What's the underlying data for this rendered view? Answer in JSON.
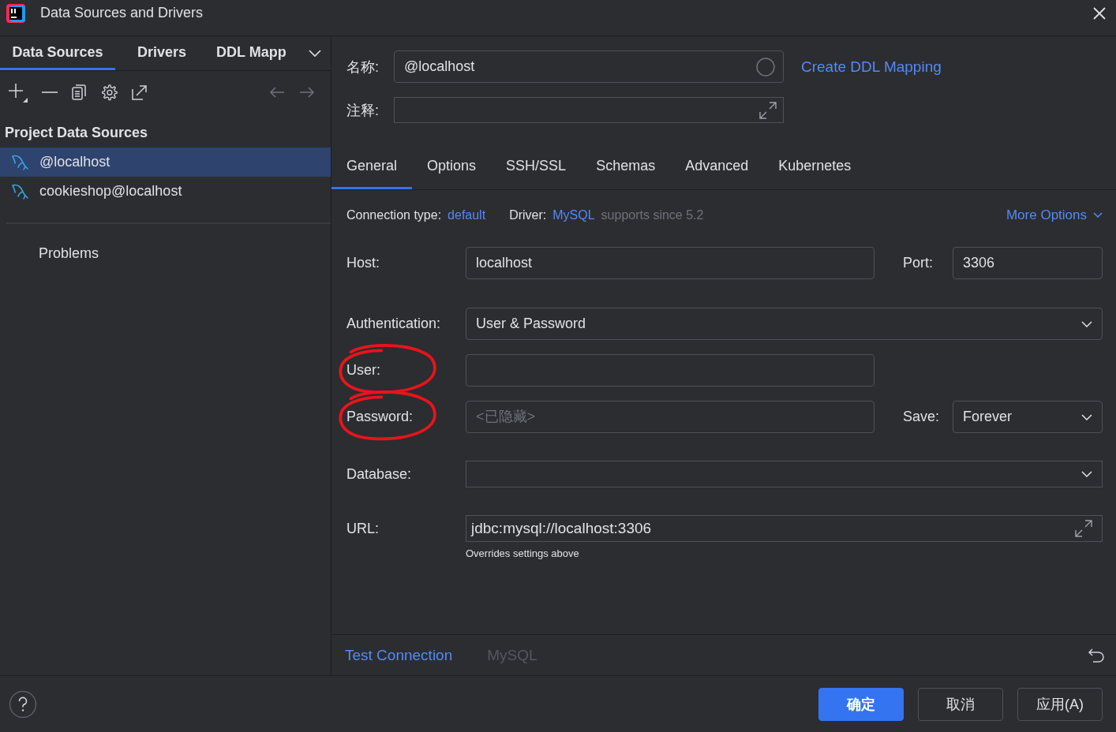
{
  "window": {
    "title": "Data Sources and Drivers"
  },
  "left_tabs": [
    {
      "label": "Data Sources",
      "selected": true
    },
    {
      "label": "Drivers",
      "selected": false
    },
    {
      "label": "DDL Mapp",
      "selected": false
    }
  ],
  "sidebar": {
    "section_title": "Project Data Sources",
    "items": [
      {
        "name": "@localhost",
        "selected": true
      },
      {
        "name": "cookieshop@localhost",
        "selected": false
      }
    ],
    "problems": "Problems"
  },
  "header": {
    "name_label": "名称:",
    "name_value": "@localhost",
    "comment_label": "注释:",
    "ddl_link": "Create DDL Mapping"
  },
  "tabs": [
    {
      "label": "General",
      "selected": true
    },
    {
      "label": "Options",
      "selected": false
    },
    {
      "label": "SSH/SSL",
      "selected": false
    },
    {
      "label": "Schemas",
      "selected": false
    },
    {
      "label": "Advanced",
      "selected": false
    },
    {
      "label": "Kubernetes",
      "selected": false
    }
  ],
  "connection": {
    "type_label": "Connection type:",
    "type_value": "default",
    "driver_label": "Driver:",
    "driver_value": "MySQL",
    "driver_note": "supports since 5.2",
    "more_options": "More Options"
  },
  "host": {
    "label": "Host:",
    "value": "localhost"
  },
  "port": {
    "label": "Port:",
    "value": "3306"
  },
  "authentication": {
    "label": "Authentication:",
    "value": "User & Password"
  },
  "user": {
    "label": "User:",
    "circled": true
  },
  "password": {
    "label": "Password:",
    "placeholder": "<已隐藏>",
    "circled": true
  },
  "save": {
    "label": "Save:",
    "value": "Forever"
  },
  "database": {
    "label": "Database:"
  },
  "url": {
    "label": "URL:",
    "value": "jdbc:mysql://localhost:3306",
    "hint": "Overrides settings above"
  },
  "footer": {
    "test_connection": "Test Connection",
    "driver_name": "MySQL",
    "driver_disabled": true
  },
  "buttons": [
    {
      "label": "确定",
      "kind": "primary"
    },
    {
      "label": "取消",
      "kind": "secondary"
    },
    {
      "label": "应用(A)",
      "kind": "secondary"
    }
  ]
}
